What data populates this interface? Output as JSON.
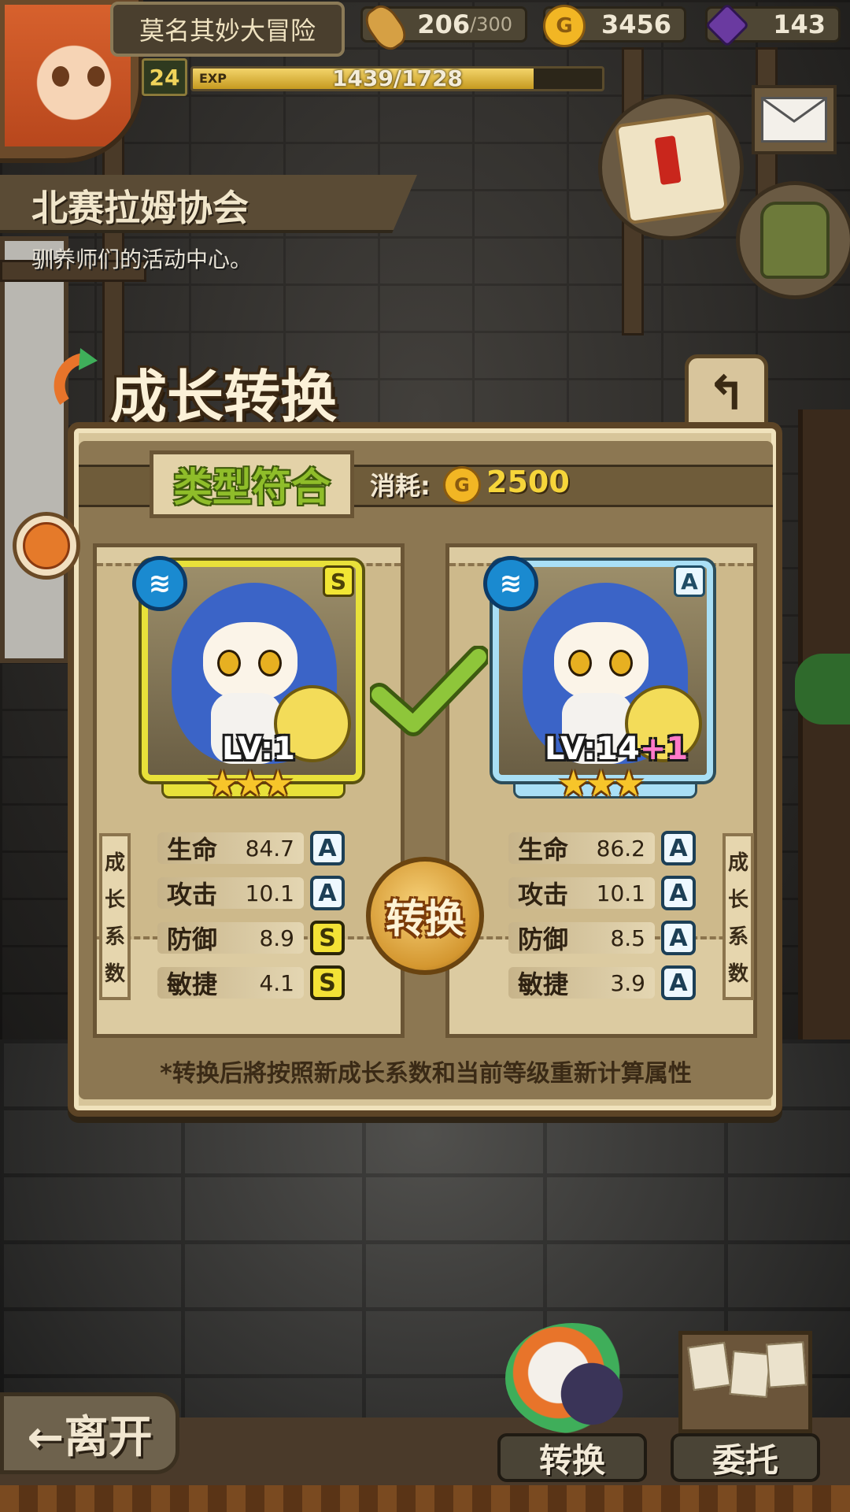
{
  "player": {
    "name": "莫名其妙大冒险",
    "level": "24",
    "exp_label": "EXP",
    "exp_text": "1439/1728",
    "exp_fraction": 0.833
  },
  "resources": {
    "stamina_current": "206",
    "stamina_max": "/300",
    "gold": "3456",
    "gems": "143",
    "gold_icon": "G"
  },
  "location": {
    "title": "北赛拉姆协会",
    "subtitle": "驯养师们的活动中心。"
  },
  "panel": {
    "title": "成长转换",
    "back_icon": "↰",
    "match_tag": "类型符合",
    "cost_label": "消耗:",
    "cost_value": "2500",
    "convert_label": "转换",
    "note": "*转换后將按照新成长系数和当前等级重新计算属性",
    "growth_label_chars": [
      "成",
      "长",
      "系",
      "数"
    ]
  },
  "left_pet": {
    "rank": "S",
    "level_text": "LV:1",
    "level_plus": "",
    "stars": "★★★",
    "element_icon": "≋",
    "stats": [
      {
        "name": "生命",
        "value": "84.7",
        "rank": "A"
      },
      {
        "name": "攻击",
        "value": "10.1",
        "rank": "A"
      },
      {
        "name": "防御",
        "value": "8.9",
        "rank": "S"
      },
      {
        "name": "敏捷",
        "value": "4.1",
        "rank": "S"
      }
    ]
  },
  "right_pet": {
    "rank": "A",
    "level_text": "LV:14",
    "level_plus": "+1",
    "stars": "★★★",
    "element_icon": "≋",
    "stats": [
      {
        "name": "生命",
        "value": "86.2",
        "rank": "A"
      },
      {
        "name": "攻击",
        "value": "10.1",
        "rank": "A"
      },
      {
        "name": "防御",
        "value": "8.5",
        "rank": "A"
      },
      {
        "name": "敏捷",
        "value": "3.9",
        "rank": "A"
      }
    ]
  },
  "bottom": {
    "leave_label": "←离开",
    "convert_nav_label": "转换",
    "commission_nav_label": "委托"
  },
  "colors": {
    "exp_fill": "#e0b830",
    "rank_s": "#f2e634",
    "rank_a": "#e9f7ff",
    "cost_text": "#f6d53a",
    "match_text": "#8fbd2a"
  }
}
